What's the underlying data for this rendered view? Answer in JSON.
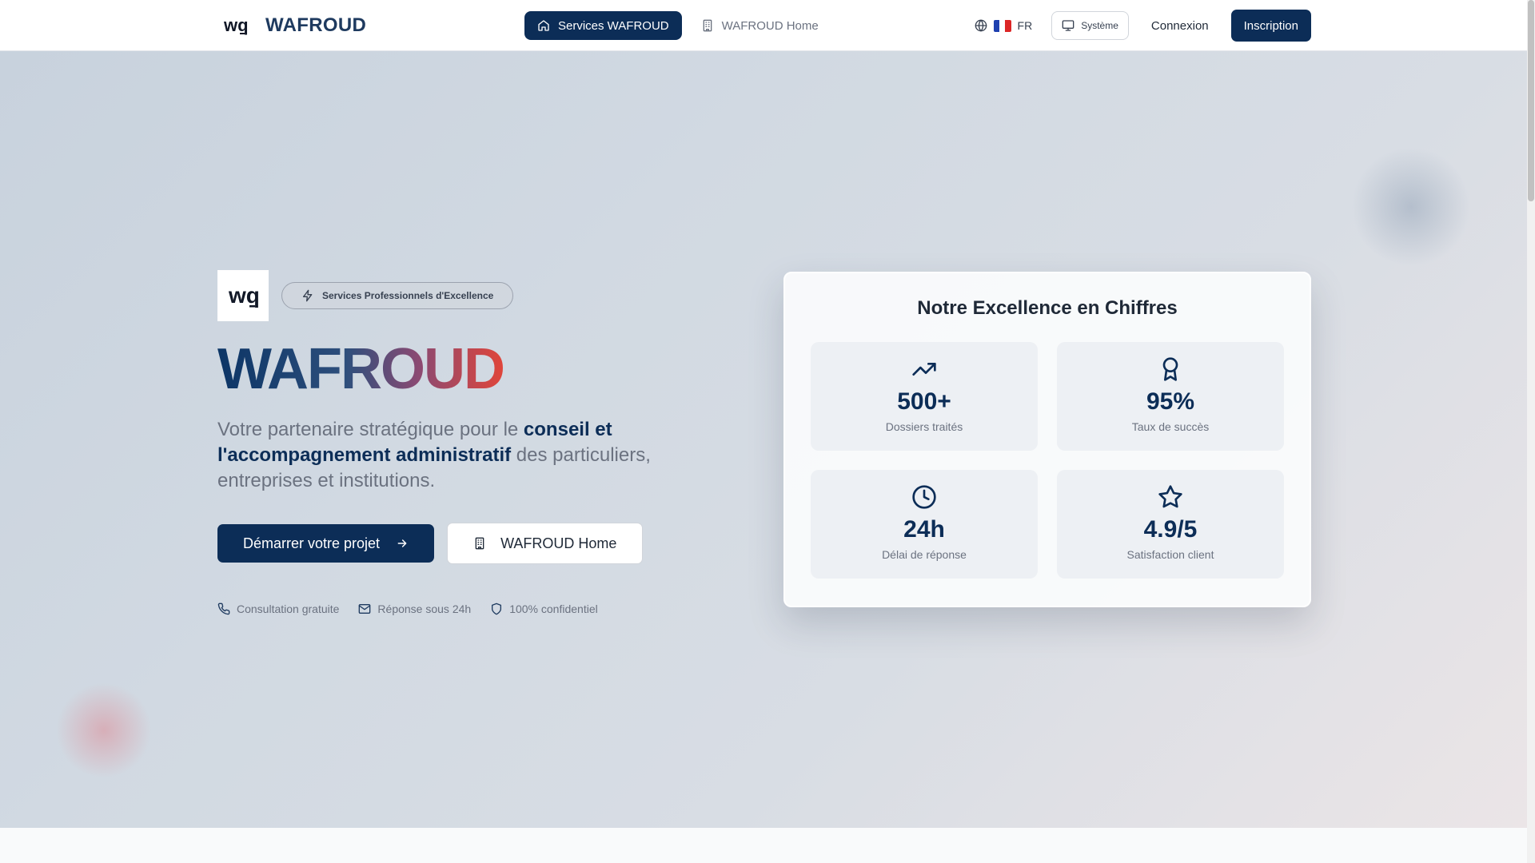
{
  "header": {
    "brand_name": "WAFROUD",
    "nav": {
      "services_label": "Services WAFROUD",
      "home_label": "WAFROUD Home"
    },
    "language": "FR",
    "theme_label": "Système",
    "login_label": "Connexion",
    "signup_label": "Inscription"
  },
  "hero": {
    "badge": "Services Professionnels d'Excellence",
    "title_part1": "WAFR",
    "title_part2": "OUD",
    "description": {
      "before": "Votre partenaire stratégique pour le ",
      "highlight": "conseil et l'accompagnement administratif",
      "after": " des particuliers, entreprises et institutions."
    },
    "cta_primary": "Démarrer votre projet",
    "cta_secondary": "WAFROUD Home",
    "features": [
      {
        "icon": "phone-icon",
        "label": "Consultation gratuite"
      },
      {
        "icon": "mail-icon",
        "label": "Réponse sous 24h"
      },
      {
        "icon": "shield-icon",
        "label": "100% confidentiel"
      }
    ]
  },
  "stats": {
    "title": "Notre Excellence en Chiffres",
    "items": [
      {
        "icon": "trending-up-icon",
        "value": "500+",
        "label": "Dossiers traités"
      },
      {
        "icon": "award-icon",
        "value": "95%",
        "label": "Taux de succès"
      },
      {
        "icon": "clock-icon",
        "value": "24h",
        "label": "Délai de réponse"
      },
      {
        "icon": "star-icon",
        "value": "4.9/5",
        "label": "Satisfaction client"
      }
    ]
  },
  "colors": {
    "primary": "#0c2d57",
    "accent_red": "#e0453a",
    "muted_text": "#6b7280"
  }
}
